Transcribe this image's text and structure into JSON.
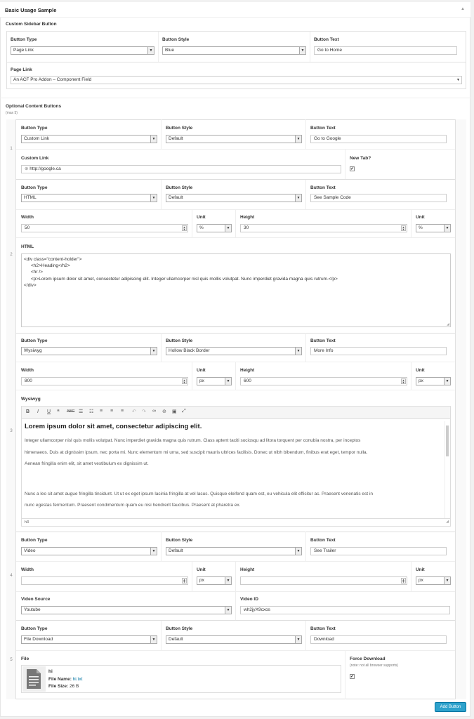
{
  "panel": {
    "title": "Basic Usage Sample",
    "toggle_icon": "triangle-up-icon"
  },
  "sidebar_button": {
    "label": "Custom Sidebar Button",
    "type": {
      "label": "Button Type",
      "value": "Page Link"
    },
    "style": {
      "label": "Button Style",
      "value": "Blue"
    },
    "text": {
      "label": "Button Text",
      "value": "Go to Home"
    },
    "page_link": {
      "label": "Page Link",
      "value": "An ACF Pro Addon – Component Field"
    }
  },
  "content_buttons": {
    "label": "Optional Content Buttons",
    "note": "(max 5)",
    "rows": [
      {
        "num": "1",
        "type": "Custom Link",
        "style": "Default",
        "text": "Go to Google",
        "custom_link_label": "Custom Link",
        "custom_link_value": "http://google.ca",
        "new_tab_label": "New Tab?",
        "new_tab_checked": "✔"
      },
      {
        "num": "2",
        "type": "HTML",
        "style": "Default",
        "text": "See Sample Code",
        "width_label": "Width",
        "width": "50",
        "unit_label": "Unit",
        "unit1": "%",
        "height_label": "Height",
        "height": "30",
        "unit2": "%",
        "html_label": "HTML",
        "html_lines": [
          "<div class=\"content-holder\">",
          "<h2>Heading</h2>",
          "<hr />",
          "<p>Lorem ipsum dolor sit amet, consectetur adipiscing elit. Integer ullamcorper nisl quis mollis volutpat. Nunc imperdiet gravida magna quis rutrum.</p>",
          "</div>"
        ]
      },
      {
        "num": "3",
        "type": "Wysiwyg",
        "style": "Hollow Black Border",
        "text": "More Info",
        "width": "800",
        "unit1": "px",
        "height": "600",
        "unit2": "px",
        "wysiwyg_label": "Wysiwyg",
        "heading": "Lorem ipsum dolor sit amet, consectetur adipiscing elit.",
        "para1": [
          "Integer ullamcorper nisl quis mollis volutpat. Nunc imperdiet gravida magna quis rutrum. Class aptent taciti sociosqu ad litora torquent per conubia nostra, per inceptos",
          "himenaeos. Duis at dignissim ipsum, nec porta mi. Nunc elementum mi urna, sed suscipit mauris ultrices facilisis. Donec ut nibh bibendum, finibus erat eget, tempor nulla.",
          "Aenean fringilla enim elit, sit amet vestibulum ex dignissim ut."
        ],
        "para2": [
          "Nunc a leo sit amet augue fringilla tincidunt. Ut ut ex eget ipsum lacinia fringilla at vel lacus. Quisque eleifend quam est, eu vehicula elit efficitur ac. Praesent venenatis est in",
          "nunc egestas fermentum. Praesent condimentum quam eu nisi hendrerit faucibus. Praesent at pharetra ex."
        ],
        "path": "h3"
      },
      {
        "num": "4",
        "type": "Video",
        "style": "Default",
        "text": "See Trailer",
        "width": "",
        "unit1": "px",
        "height": "",
        "unit2": "px",
        "source_label": "Video Source",
        "source": "Youtube",
        "id_label": "Video ID",
        "video_id": "wh2jyX9cxos"
      },
      {
        "num": "5",
        "type": "File Download",
        "style": "Default",
        "text": "Download",
        "file_label": "File",
        "file_title": "hi",
        "file_name_label": "File Name:",
        "file_name": "hi.txt",
        "file_size_label": "File Size:",
        "file_size": "26 B",
        "force_label": "Force Download",
        "force_note": "(note: not all browser supports)",
        "force_checked": "✔"
      }
    ]
  },
  "add_button": "Add Button",
  "colors": {
    "primary": "#2ea2cc",
    "link": "#0074a2"
  }
}
